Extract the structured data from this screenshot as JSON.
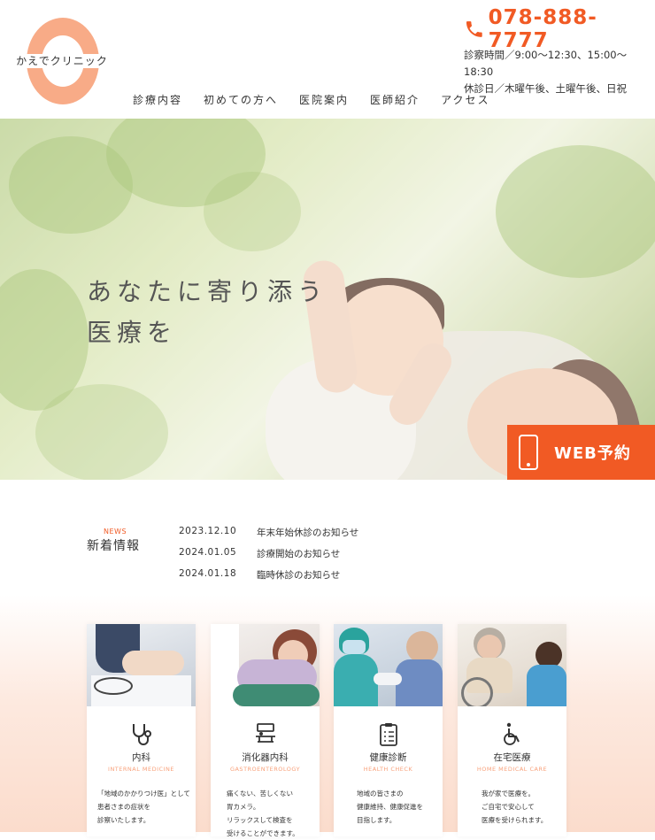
{
  "header": {
    "logo_text": "かえでクリニック",
    "phone": "078-888-7777",
    "hours_line1": "診察時間／9:00〜12:30、15:00〜18:30",
    "hours_line2": "休診日／木曜午後、土曜午後、日祝",
    "nav": [
      "診療内容",
      "初めての方へ",
      "医院案内",
      "医師紹介",
      "アクセス"
    ]
  },
  "hero": {
    "line1": "あなたに寄り添う",
    "line2": "医療を",
    "web_button": "WEB予約"
  },
  "news": {
    "label_en": "NEWS",
    "title": "新着情報",
    "items": [
      {
        "date": "2023.12.10",
        "text": "年末年始休診のお知らせ"
      },
      {
        "date": "2024.01.05",
        "text": "診療開始のお知らせ"
      },
      {
        "date": "2024.01.18",
        "text": "臨時休診のお知らせ"
      }
    ]
  },
  "services": [
    {
      "title": "内科",
      "en": "INTERNAL MEDICINE",
      "icon": "stethoscope-icon",
      "desc": "「地域のかかりつけ医」として\n患者さまの症状を\n診察いたします。"
    },
    {
      "title": "消化器内科",
      "en": "GASTROENTEROLOGY",
      "icon": "endoscopy-bed-icon",
      "desc": "痛くない、苦しくない\n胃カメラ。\nリラックスして検査を\n受けることができます。"
    },
    {
      "title": "健康診断",
      "en": "HEALTH CHECK",
      "icon": "clipboard-checklist-icon",
      "desc": "地域の皆さまの\n健康維持、健康促進を\n目指します。"
    },
    {
      "title": "在宅医療",
      "en": "HOME MEDICAL CARE",
      "icon": "wheelchair-icon",
      "desc": "我が家で医療を。\nご自宅で安心して\n医療を受けられます。"
    }
  ],
  "colors": {
    "accent": "#f15a24",
    "logo": "#f8ab87",
    "sub_accent": "#f8a07a"
  }
}
